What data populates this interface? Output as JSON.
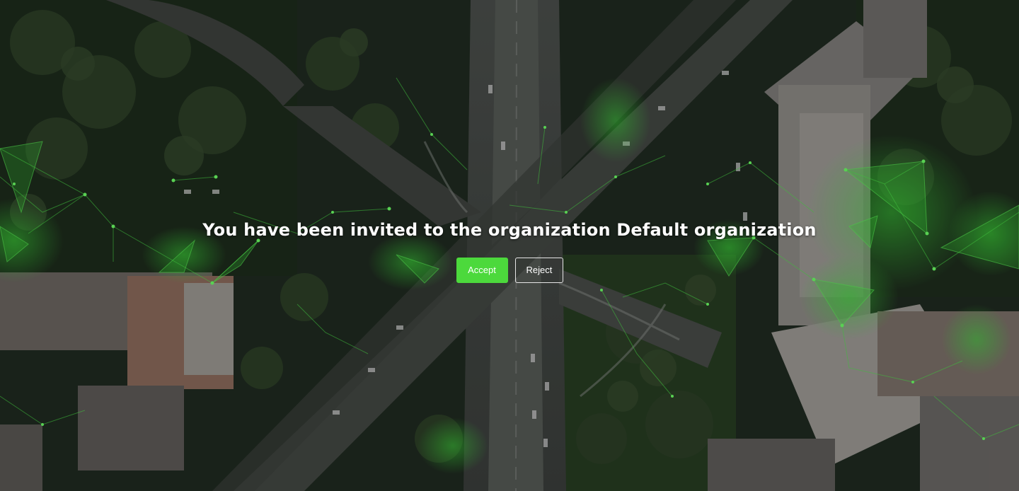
{
  "invitation": {
    "title": "You have been invited to the organization Default organization",
    "accept_label": "Accept",
    "reject_label": "Reject"
  },
  "colors": {
    "accent": "#4cd93c",
    "text": "#ffffff",
    "network_glow": "#3ddc3a"
  }
}
